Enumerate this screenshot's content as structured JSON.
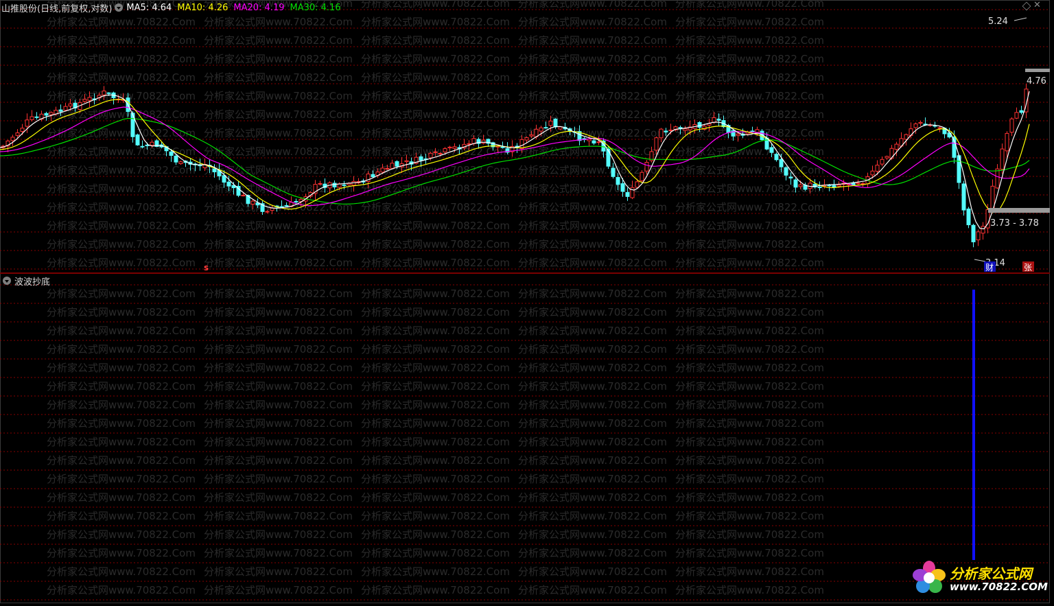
{
  "main_panel": {
    "title": "山推股份(日线,前复权,对数)",
    "ma_items": [
      {
        "label": "MA5: 4.64",
        "color": "#ffffff"
      },
      {
        "label": "MA10: 4.26",
        "color": "#ffff00"
      },
      {
        "label": "MA20: 4.19",
        "color": "#ff00ff"
      },
      {
        "label": "MA30: 4.16",
        "color": "#00e000"
      }
    ],
    "price_labels": {
      "high": "5.24",
      "current": "4.76",
      "gap_zone": "3.73 - 3.78",
      "low": "3.14"
    },
    "markers": {
      "s_marker": "s",
      "cai_marker": "财",
      "zhang_marker": "张"
    }
  },
  "sub_panel": {
    "title": "波波抄底"
  },
  "watermark": "分析家公式网www.70822.Com",
  "logo": {
    "name": "分析家公式网",
    "url": "www.70822.COM"
  },
  "colors": {
    "up": "#ff3232",
    "down": "#54fcfc",
    "ma5": "#ffffff",
    "ma10": "#ffff00",
    "ma20": "#ff00ff",
    "ma30": "#00e000",
    "signal_bar": "#1010ff",
    "grid": "#8a0000"
  }
}
